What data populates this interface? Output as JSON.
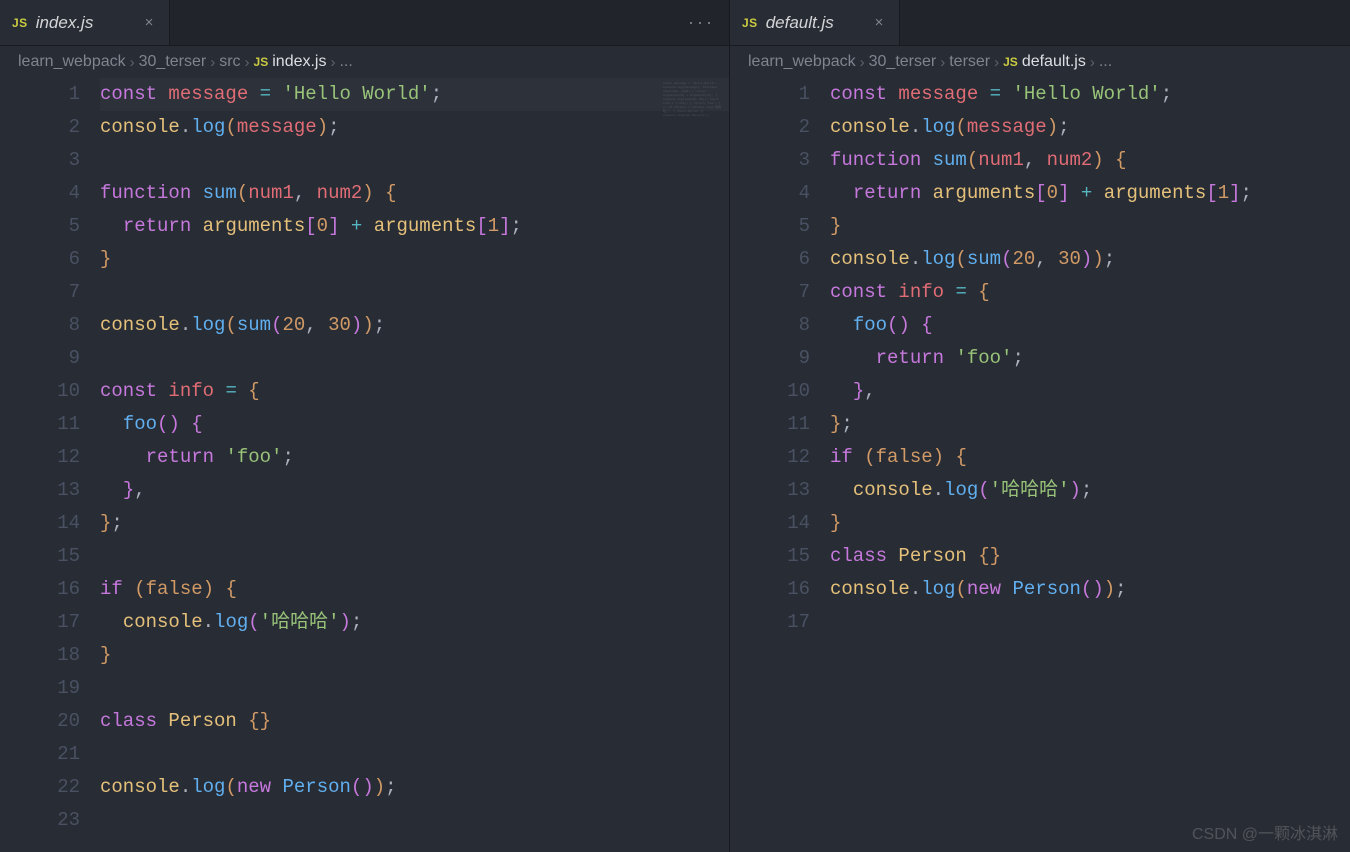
{
  "watermark": "CSDN @一颗冰淇淋",
  "panes": [
    {
      "id": "left",
      "tab": {
        "icon": "JS",
        "title": "index.js",
        "closeable": true
      },
      "actions_overflow": "···",
      "breadcrumb": [
        {
          "type": "folder",
          "label": "learn_webpack"
        },
        {
          "type": "folder",
          "label": "30_terser"
        },
        {
          "type": "folder",
          "label": "src"
        },
        {
          "type": "file",
          "icon": "JS",
          "label": "index.js"
        },
        {
          "type": "symbol",
          "label": "..."
        }
      ],
      "lines": [
        {
          "n": 1,
          "hl": true,
          "t": [
            [
              "kw",
              "const"
            ],
            [
              "punc",
              " "
            ],
            [
              "var",
              "message"
            ],
            [
              "punc",
              " "
            ],
            [
              "op",
              "="
            ],
            [
              "punc",
              " "
            ],
            [
              "str",
              "'Hello World'"
            ],
            [
              "punc",
              ";"
            ]
          ]
        },
        {
          "n": 2,
          "t": [
            [
              "cls",
              "console"
            ],
            [
              "punc",
              "."
            ],
            [
              "fn",
              "log"
            ],
            [
              "bry",
              "("
            ],
            [
              "var",
              "message"
            ],
            [
              "bry",
              ")"
            ],
            [
              "punc",
              ";"
            ]
          ]
        },
        {
          "n": 3,
          "t": []
        },
        {
          "n": 4,
          "t": [
            [
              "kw",
              "function"
            ],
            [
              "punc",
              " "
            ],
            [
              "fn",
              "sum"
            ],
            [
              "bry",
              "("
            ],
            [
              "var",
              "num1"
            ],
            [
              "punc",
              ", "
            ],
            [
              "var",
              "num2"
            ],
            [
              "bry",
              ")"
            ],
            [
              "punc",
              " "
            ],
            [
              "bry",
              "{"
            ]
          ]
        },
        {
          "n": 5,
          "t": [
            [
              "punc",
              "  "
            ],
            [
              "kw",
              "return"
            ],
            [
              "punc",
              " "
            ],
            [
              "cls",
              "arguments"
            ],
            [
              "brp",
              "["
            ],
            [
              "num",
              "0"
            ],
            [
              "brp",
              "]"
            ],
            [
              "punc",
              " "
            ],
            [
              "op",
              "+"
            ],
            [
              "punc",
              " "
            ],
            [
              "cls",
              "arguments"
            ],
            [
              "brp",
              "["
            ],
            [
              "num",
              "1"
            ],
            [
              "brp",
              "]"
            ],
            [
              "punc",
              ";"
            ]
          ]
        },
        {
          "n": 6,
          "t": [
            [
              "bry",
              "}"
            ]
          ]
        },
        {
          "n": 7,
          "t": []
        },
        {
          "n": 8,
          "t": [
            [
              "cls",
              "console"
            ],
            [
              "punc",
              "."
            ],
            [
              "fn",
              "log"
            ],
            [
              "bry",
              "("
            ],
            [
              "fn",
              "sum"
            ],
            [
              "brp",
              "("
            ],
            [
              "num",
              "20"
            ],
            [
              "punc",
              ", "
            ],
            [
              "num",
              "30"
            ],
            [
              "brp",
              ")"
            ],
            [
              "bry",
              ")"
            ],
            [
              "punc",
              ";"
            ]
          ]
        },
        {
          "n": 9,
          "t": []
        },
        {
          "n": 10,
          "t": [
            [
              "kw",
              "const"
            ],
            [
              "punc",
              " "
            ],
            [
              "var",
              "info"
            ],
            [
              "punc",
              " "
            ],
            [
              "op",
              "="
            ],
            [
              "punc",
              " "
            ],
            [
              "bry",
              "{"
            ]
          ]
        },
        {
          "n": 11,
          "t": [
            [
              "punc",
              "  "
            ],
            [
              "fn",
              "foo"
            ],
            [
              "brp",
              "("
            ],
            [
              "brp",
              ")"
            ],
            [
              "punc",
              " "
            ],
            [
              "brp",
              "{"
            ]
          ]
        },
        {
          "n": 12,
          "t": [
            [
              "punc",
              "    "
            ],
            [
              "kw",
              "return"
            ],
            [
              "punc",
              " "
            ],
            [
              "str",
              "'foo'"
            ],
            [
              "punc",
              ";"
            ]
          ]
        },
        {
          "n": 13,
          "t": [
            [
              "punc",
              "  "
            ],
            [
              "brp",
              "}"
            ],
            [
              "punc",
              ","
            ]
          ]
        },
        {
          "n": 14,
          "t": [
            [
              "bry",
              "}"
            ],
            [
              "punc",
              ";"
            ]
          ]
        },
        {
          "n": 15,
          "t": []
        },
        {
          "n": 16,
          "t": [
            [
              "kw",
              "if"
            ],
            [
              "punc",
              " "
            ],
            [
              "bry",
              "("
            ],
            [
              "bool",
              "false"
            ],
            [
              "bry",
              ")"
            ],
            [
              "punc",
              " "
            ],
            [
              "bry",
              "{"
            ]
          ]
        },
        {
          "n": 17,
          "t": [
            [
              "punc",
              "  "
            ],
            [
              "cls",
              "console"
            ],
            [
              "punc",
              "."
            ],
            [
              "fn",
              "log"
            ],
            [
              "brp",
              "("
            ],
            [
              "str",
              "'哈哈哈'"
            ],
            [
              "brp",
              ")"
            ],
            [
              "punc",
              ";"
            ]
          ]
        },
        {
          "n": 18,
          "t": [
            [
              "bry",
              "}"
            ]
          ]
        },
        {
          "n": 19,
          "t": []
        },
        {
          "n": 20,
          "t": [
            [
              "kw",
              "class"
            ],
            [
              "punc",
              " "
            ],
            [
              "cls",
              "Person"
            ],
            [
              "punc",
              " "
            ],
            [
              "bry",
              "{"
            ],
            [
              "bry",
              "}"
            ]
          ]
        },
        {
          "n": 21,
          "t": []
        },
        {
          "n": 22,
          "t": [
            [
              "cls",
              "console"
            ],
            [
              "punc",
              "."
            ],
            [
              "fn",
              "log"
            ],
            [
              "bry",
              "("
            ],
            [
              "kw",
              "new"
            ],
            [
              "punc",
              " "
            ],
            [
              "fn",
              "Person"
            ],
            [
              "brp",
              "("
            ],
            [
              "brp",
              ")"
            ],
            [
              "bry",
              ")"
            ],
            [
              "punc",
              ";"
            ]
          ]
        },
        {
          "n": 23,
          "t": []
        }
      ]
    },
    {
      "id": "right",
      "tab": {
        "icon": "JS",
        "title": "default.js",
        "closeable": true
      },
      "breadcrumb": [
        {
          "type": "folder",
          "label": "learn_webpack"
        },
        {
          "type": "folder",
          "label": "30_terser"
        },
        {
          "type": "folder",
          "label": "terser"
        },
        {
          "type": "file",
          "icon": "JS",
          "label": "default.js"
        },
        {
          "type": "symbol",
          "label": "..."
        }
      ],
      "lines": [
        {
          "n": 1,
          "t": [
            [
              "kw",
              "const"
            ],
            [
              "punc",
              " "
            ],
            [
              "var",
              "message"
            ],
            [
              "punc",
              " "
            ],
            [
              "op",
              "="
            ],
            [
              "punc",
              " "
            ],
            [
              "str",
              "'Hello World'"
            ],
            [
              "punc",
              ";"
            ]
          ]
        },
        {
          "n": 2,
          "t": [
            [
              "cls",
              "console"
            ],
            [
              "punc",
              "."
            ],
            [
              "fn",
              "log"
            ],
            [
              "bry",
              "("
            ],
            [
              "var",
              "message"
            ],
            [
              "bry",
              ")"
            ],
            [
              "punc",
              ";"
            ]
          ]
        },
        {
          "n": 3,
          "t": [
            [
              "kw",
              "function"
            ],
            [
              "punc",
              " "
            ],
            [
              "fn",
              "sum"
            ],
            [
              "bry",
              "("
            ],
            [
              "var",
              "num1"
            ],
            [
              "punc",
              ", "
            ],
            [
              "var",
              "num2"
            ],
            [
              "bry",
              ")"
            ],
            [
              "punc",
              " "
            ],
            [
              "bry",
              "{"
            ]
          ]
        },
        {
          "n": 4,
          "t": [
            [
              "punc",
              "  "
            ],
            [
              "kw",
              "return"
            ],
            [
              "punc",
              " "
            ],
            [
              "cls",
              "arguments"
            ],
            [
              "brp",
              "["
            ],
            [
              "num",
              "0"
            ],
            [
              "brp",
              "]"
            ],
            [
              "punc",
              " "
            ],
            [
              "op",
              "+"
            ],
            [
              "punc",
              " "
            ],
            [
              "cls",
              "arguments"
            ],
            [
              "brp",
              "["
            ],
            [
              "num",
              "1"
            ],
            [
              "brp",
              "]"
            ],
            [
              "punc",
              ";"
            ]
          ]
        },
        {
          "n": 5,
          "t": [
            [
              "bry",
              "}"
            ]
          ]
        },
        {
          "n": 6,
          "t": [
            [
              "cls",
              "console"
            ],
            [
              "punc",
              "."
            ],
            [
              "fn",
              "log"
            ],
            [
              "bry",
              "("
            ],
            [
              "fn",
              "sum"
            ],
            [
              "brp",
              "("
            ],
            [
              "num",
              "20"
            ],
            [
              "punc",
              ", "
            ],
            [
              "num",
              "30"
            ],
            [
              "brp",
              ")"
            ],
            [
              "bry",
              ")"
            ],
            [
              "punc",
              ";"
            ]
          ]
        },
        {
          "n": 7,
          "t": [
            [
              "kw",
              "const"
            ],
            [
              "punc",
              " "
            ],
            [
              "var",
              "info"
            ],
            [
              "punc",
              " "
            ],
            [
              "op",
              "="
            ],
            [
              "punc",
              " "
            ],
            [
              "bry",
              "{"
            ]
          ]
        },
        {
          "n": 8,
          "t": [
            [
              "punc",
              "  "
            ],
            [
              "fn",
              "foo"
            ],
            [
              "brp",
              "("
            ],
            [
              "brp",
              ")"
            ],
            [
              "punc",
              " "
            ],
            [
              "brp",
              "{"
            ]
          ]
        },
        {
          "n": 9,
          "t": [
            [
              "punc",
              "    "
            ],
            [
              "kw",
              "return"
            ],
            [
              "punc",
              " "
            ],
            [
              "str",
              "'foo'"
            ],
            [
              "punc",
              ";"
            ]
          ]
        },
        {
          "n": 10,
          "t": [
            [
              "punc",
              "  "
            ],
            [
              "brp",
              "}"
            ],
            [
              "punc",
              ","
            ]
          ]
        },
        {
          "n": 11,
          "t": [
            [
              "bry",
              "}"
            ],
            [
              "punc",
              ";"
            ]
          ]
        },
        {
          "n": 12,
          "t": [
            [
              "kw",
              "if"
            ],
            [
              "punc",
              " "
            ],
            [
              "bry",
              "("
            ],
            [
              "bool",
              "false"
            ],
            [
              "bry",
              ")"
            ],
            [
              "punc",
              " "
            ],
            [
              "bry",
              "{"
            ]
          ]
        },
        {
          "n": 13,
          "t": [
            [
              "punc",
              "  "
            ],
            [
              "cls",
              "console"
            ],
            [
              "punc",
              "."
            ],
            [
              "fn",
              "log"
            ],
            [
              "brp",
              "("
            ],
            [
              "str",
              "'哈哈哈'"
            ],
            [
              "brp",
              ")"
            ],
            [
              "punc",
              ";"
            ]
          ]
        },
        {
          "n": 14,
          "t": [
            [
              "bry",
              "}"
            ]
          ]
        },
        {
          "n": 15,
          "t": [
            [
              "kw",
              "class"
            ],
            [
              "punc",
              " "
            ],
            [
              "cls",
              "Person"
            ],
            [
              "punc",
              " "
            ],
            [
              "bry",
              "{"
            ],
            [
              "bry",
              "}"
            ]
          ]
        },
        {
          "n": 16,
          "t": [
            [
              "cls",
              "console"
            ],
            [
              "punc",
              "."
            ],
            [
              "fn",
              "log"
            ],
            [
              "bry",
              "("
            ],
            [
              "kw",
              "new"
            ],
            [
              "punc",
              " "
            ],
            [
              "fn",
              "Person"
            ],
            [
              "brp",
              "("
            ],
            [
              "brp",
              ")"
            ],
            [
              "bry",
              ")"
            ],
            [
              "punc",
              ";"
            ]
          ]
        },
        {
          "n": 17,
          "t": []
        }
      ]
    }
  ]
}
